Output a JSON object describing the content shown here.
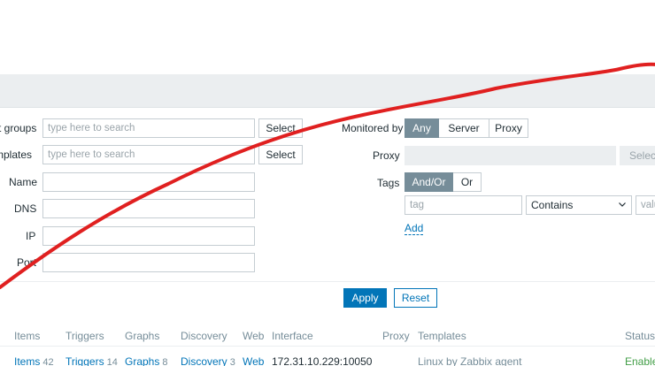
{
  "filter": {
    "host_groups": {
      "label": "t groups",
      "placeholder": "type here to search",
      "select_label": "Select"
    },
    "templates": {
      "label": "mplates",
      "placeholder": "type here to search",
      "select_label": "Select"
    },
    "name_label": "Name",
    "dns_label": "DNS",
    "ip_label": "IP",
    "port_label": "Port",
    "monitored_by": {
      "label": "Monitored by",
      "options": [
        "Any",
        "Server",
        "Proxy"
      ],
      "selected": "Any"
    },
    "proxy": {
      "label": "Proxy",
      "select_label": "Selec"
    },
    "tags": {
      "label": "Tags",
      "operator_options": [
        "And/Or",
        "Or"
      ],
      "operator_selected": "And/Or",
      "tag_placeholder": "tag",
      "condition": "Contains",
      "value_placeholder": "valu",
      "add_label": "Add"
    },
    "apply_label": "Apply",
    "reset_label": "Reset"
  },
  "table": {
    "columns": [
      "Items",
      "Triggers",
      "Graphs",
      "Discovery",
      "Web",
      "Interface",
      "Proxy",
      "Templates",
      "Status"
    ],
    "rows": [
      {
        "items": "Items",
        "items_count": "42",
        "triggers": "Triggers",
        "triggers_count": "14",
        "graphs": "Graphs",
        "graphs_count": "8",
        "discovery": "Discovery",
        "discovery_count": "3",
        "web": "Web",
        "interface": "172.31.10.229:10050",
        "templates": "Linux by Zabbix agent",
        "status": "Enable"
      }
    ]
  },
  "colors": {
    "accent": "#0275b8",
    "segment_active": "#768d99",
    "status_enabled": "#429e47",
    "annotation_curve": "#e02020"
  }
}
